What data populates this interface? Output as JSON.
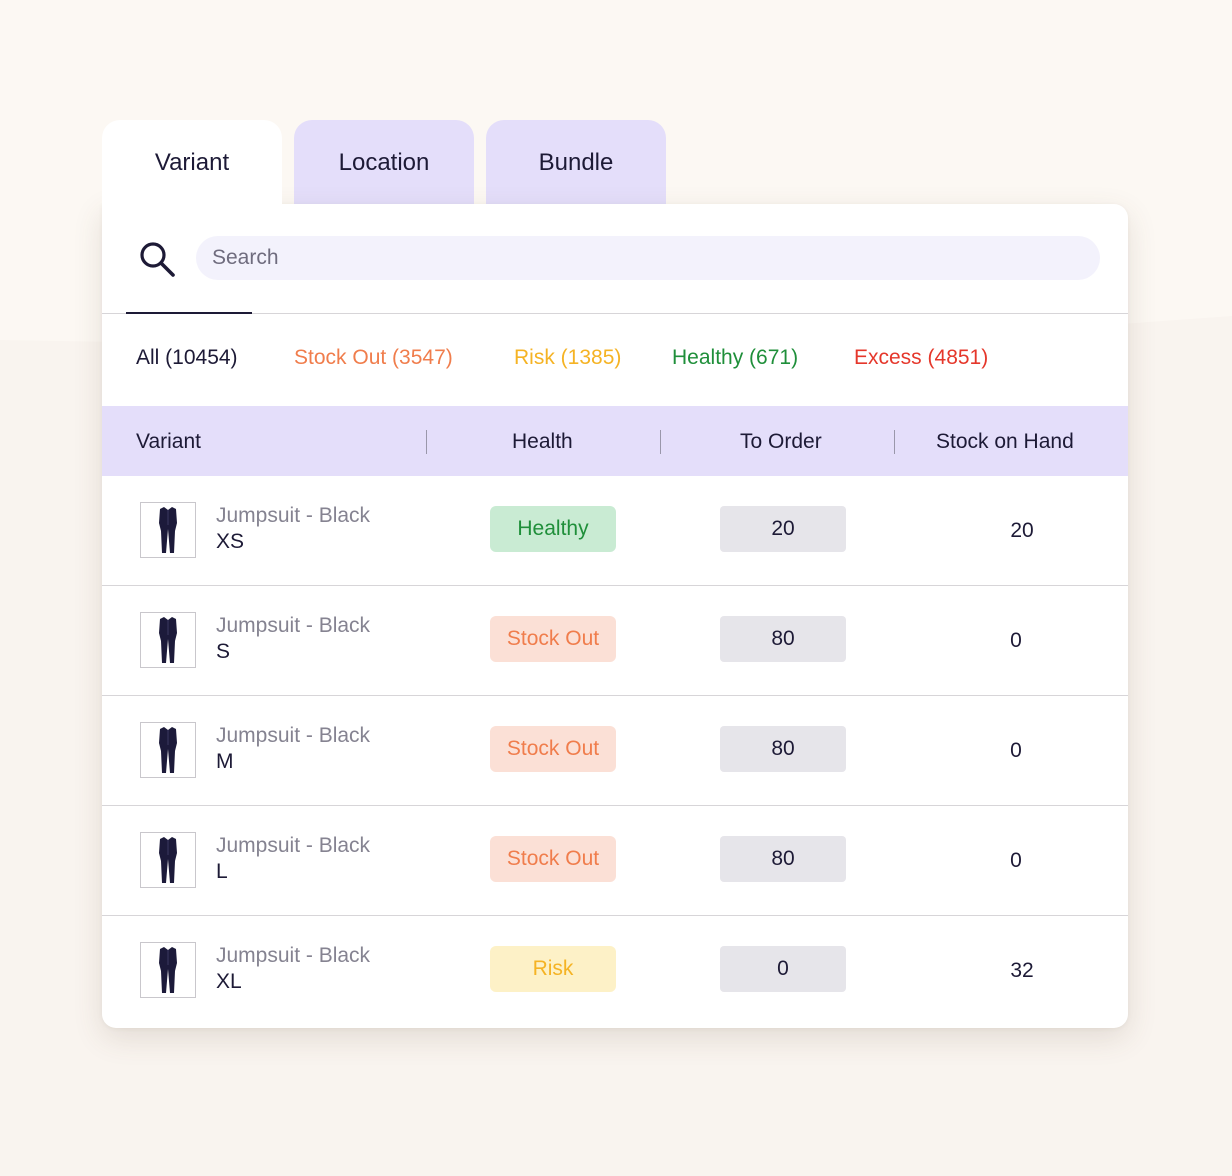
{
  "tabs": [
    {
      "label": "Variant",
      "active": true
    },
    {
      "label": "Location",
      "active": false
    },
    {
      "label": "Bundle",
      "active": false
    }
  ],
  "search": {
    "placeholder": "Search",
    "icon": "search-icon"
  },
  "filters": [
    {
      "label": "All (10454)",
      "color": "#1d1a36"
    },
    {
      "label": "Stock Out (3547)",
      "color": "#f07d4c"
    },
    {
      "label": "Risk (1385)",
      "color": "#f5b324"
    },
    {
      "label": "Healthy (671)",
      "color": "#1f8f3a"
    },
    {
      "label": "Excess (4851)",
      "color": "#e5372b"
    }
  ],
  "table": {
    "headers": [
      "Variant",
      "Health",
      "To Order",
      "Stock on Hand"
    ],
    "rows": [
      {
        "name": "Jumpsuit - Black",
        "size": "XS",
        "health": "Healthy",
        "to_order": "20",
        "stock_on_hand": "20"
      },
      {
        "name": "Jumpsuit - Black",
        "size": "S",
        "health": "Stock Out",
        "to_order": "80",
        "stock_on_hand": "0"
      },
      {
        "name": "Jumpsuit - Black",
        "size": "M",
        "health": "Stock Out",
        "to_order": "80",
        "stock_on_hand": "0"
      },
      {
        "name": "Jumpsuit - Black",
        "size": "L",
        "health": "Stock Out",
        "to_order": "80",
        "stock_on_hand": "0"
      },
      {
        "name": "Jumpsuit - Black",
        "size": "XL",
        "health": "Risk",
        "to_order": "0",
        "stock_on_hand": "32"
      }
    ]
  },
  "health_styles": {
    "Healthy": {
      "bg": "#c9ebd3",
      "fg": "#1f8f3a"
    },
    "Stock Out": {
      "bg": "#fbe0d6",
      "fg": "#f07d4c"
    },
    "Risk": {
      "bg": "#fdf1c7",
      "fg": "#f5b324"
    }
  }
}
